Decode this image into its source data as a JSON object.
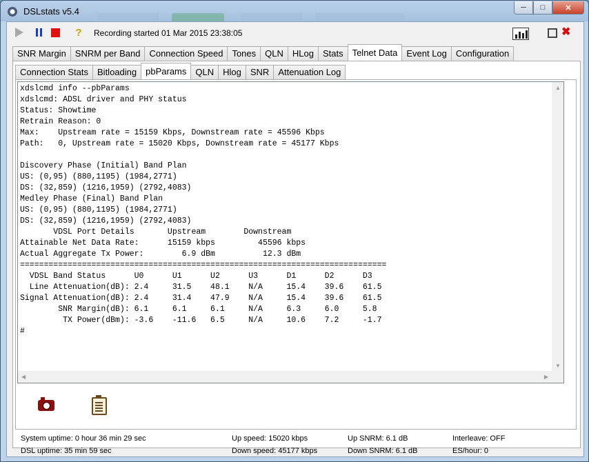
{
  "window": {
    "title": "DSLstats v5.4"
  },
  "toolbar": {
    "recording_text": "Recording started 01 Mar 2015 23:38:05"
  },
  "main_tabs": [
    "SNR Margin",
    "SNRM per Band",
    "Connection Speed",
    "Tones",
    "QLN",
    "HLog",
    "Stats",
    "Telnet Data",
    "Event Log",
    "Configuration"
  ],
  "main_active": "Telnet Data",
  "sub_tabs": [
    "Connection Stats",
    "Bitloading",
    "pbParams",
    "QLN",
    "Hlog",
    "SNR",
    "Attenuation Log"
  ],
  "sub_active": "pbParams",
  "console_lines": [
    "xdslcmd info --pbParams",
    "xdslcmd: ADSL driver and PHY status",
    "Status: Showtime",
    "Retrain Reason: 0",
    "Max:    Upstream rate = 15159 Kbps, Downstream rate = 45596 Kbps",
    "Path:   0, Upstream rate = 15020 Kbps, Downstream rate = 45177 Kbps",
    "",
    "Discovery Phase (Initial) Band Plan",
    "US: (0,95) (880,1195) (1984,2771)",
    "DS: (32,859) (1216,1959) (2792,4083)",
    "Medley Phase (Final) Band Plan",
    "US: (0,95) (880,1195) (1984,2771)",
    "DS: (32,859) (1216,1959) (2792,4083)",
    "       VDSL Port Details       Upstream        Downstream",
    "Attainable Net Data Rate:      15159 kbps         45596 kbps",
    "Actual Aggregate Tx Power:        6.9 dBm          12.3 dBm",
    "=============================================================================",
    "  VDSL Band Status      U0      U1      U2      U3      D1      D2      D3",
    "  Line Attenuation(dB): 2.4     31.5    48.1    N/A     15.4    39.6    61.5",
    "Signal Attenuation(dB): 2.4     31.4    47.9    N/A     15.4    39.6    61.5",
    "        SNR Margin(dB): 6.1     6.1     6.1     N/A     6.3     6.0     5.8",
    "         TX Power(dBm): -3.6    -11.6   6.5     N/A     10.6    7.2     -1.7",
    "#"
  ],
  "status": {
    "system_uptime": "System uptime:  0 hour 36 min 29 sec",
    "dsl_uptime": "DSL uptime: 35 min 59 sec",
    "up_speed": "Up speed: 15020 kbps",
    "down_speed": "Down speed: 45177 kbps",
    "up_snrm": "Up SNRM: 6.1 dB",
    "down_snrm": "Down SNRM: 6.1 dB",
    "interleave": "Interleave: OFF",
    "es_hour": "ES/hour: 0"
  },
  "icons": [
    "app-icon",
    "play-icon",
    "pause-icon",
    "stop-icon",
    "lightbulb-icon",
    "chart-window-icon",
    "restore-icon",
    "close-small-icon",
    "camera-icon",
    "clipboard-icon"
  ],
  "colors": {
    "stop": "#e01010",
    "pause": "#1a3cc0",
    "close": "#c8422a"
  }
}
